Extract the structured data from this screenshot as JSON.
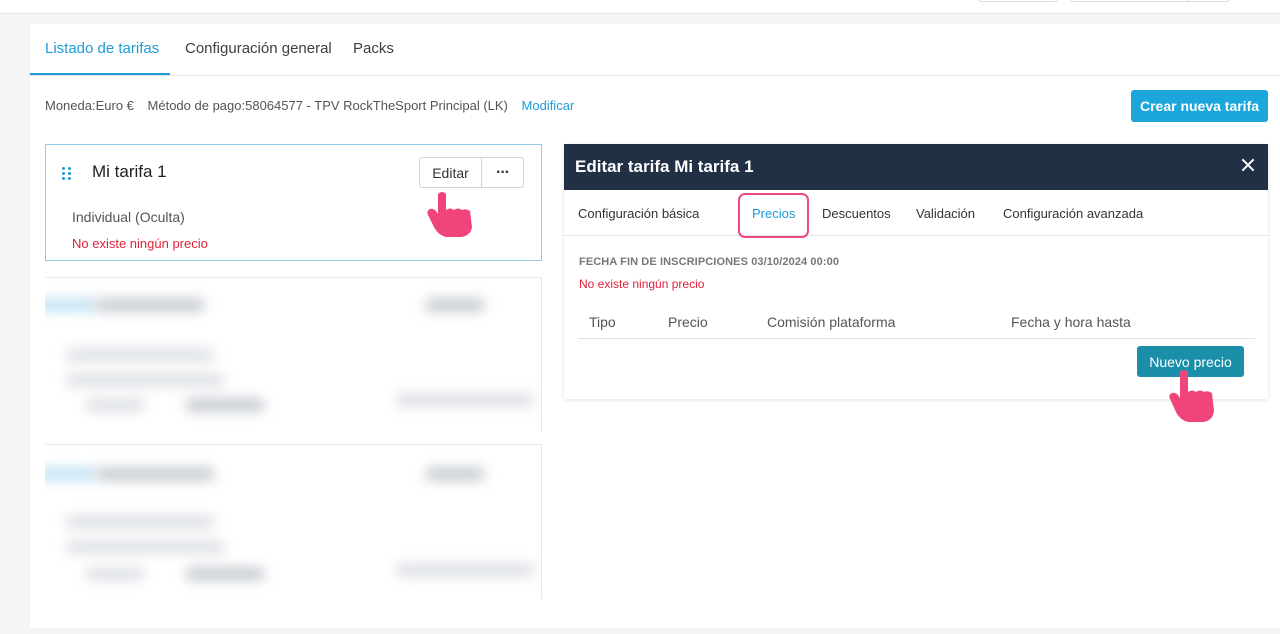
{
  "tabs": [
    {
      "label": "Listado de tarifas",
      "active": true
    },
    {
      "label": "Configuración general",
      "active": false
    },
    {
      "label": "Packs",
      "active": false
    }
  ],
  "info": {
    "currency": "Moneda:Euro €",
    "payment": "Método de pago:58064577 - TPV RockTheSport Principal (LK)",
    "modify_link": "Modificar"
  },
  "create_button": "Crear nueva tarifa",
  "tariff_card": {
    "title": "Mi tarifa 1",
    "edit_label": "Editar",
    "more_label": "···",
    "subtitle": "Individual (Oculta)",
    "error": "No existe ningún precio"
  },
  "modal": {
    "title": "Editar tarifa Mi tarifa 1",
    "tabs": [
      {
        "label": "Configuración básica"
      },
      {
        "label": "Precios"
      },
      {
        "label": "Descuentos"
      },
      {
        "label": "Validación"
      },
      {
        "label": "Configuración avanzada"
      }
    ],
    "active_tab": "Precios",
    "section_label": "FECHA FIN DE INSCRIPCIONES 03/10/2024 00:00",
    "error": "No existe ningún precio",
    "columns": [
      "Tipo",
      "Precio",
      "Comisión plataforma",
      "Fecha y hora hasta"
    ],
    "new_price_button": "Nuevo precio"
  },
  "colors": {
    "accent": "#1e9bd7",
    "primary_button": "#1ca7dc",
    "modal_header": "#223046",
    "error": "#e0213a",
    "highlight": "#ee4a7c",
    "hand": "#f0457a"
  },
  "icons": [
    "drag-handle-icon",
    "close-icon",
    "pointer-hand-icon"
  ]
}
